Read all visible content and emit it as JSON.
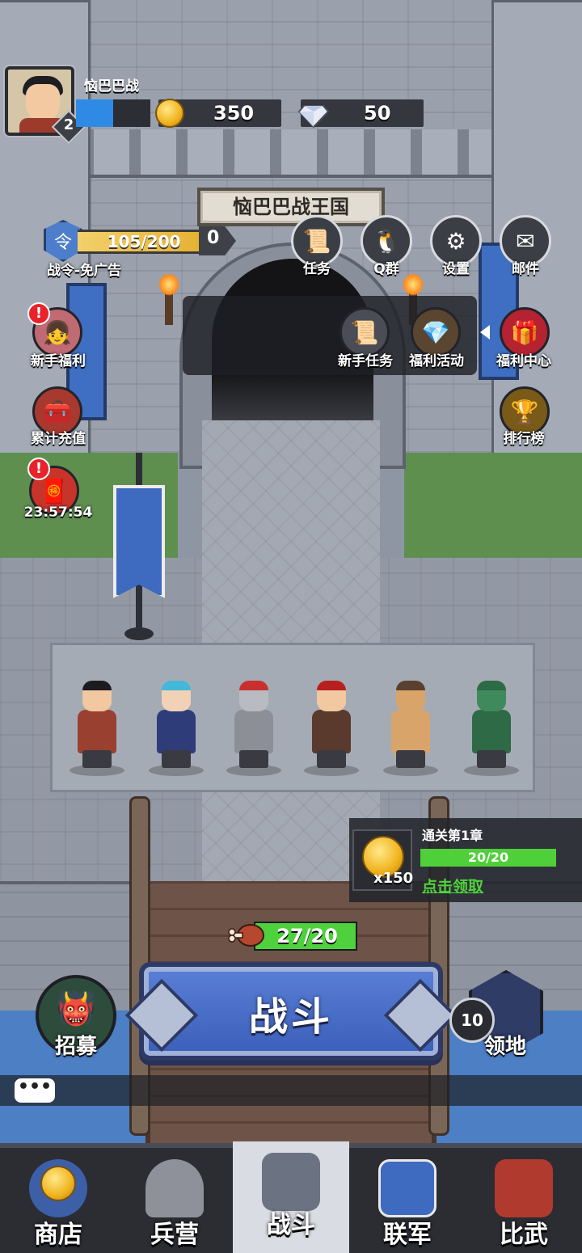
{
  "player": {
    "name": "恼巴巴战",
    "level": "2",
    "xp_fraction": 0.5,
    "gold": "350",
    "diamonds": "50"
  },
  "kingdom": {
    "title": "恼巴巴战王国"
  },
  "battle_pass": {
    "progress": "105/200",
    "progress_fraction": 0.525,
    "reward_count": "0",
    "label": "战令-免广告"
  },
  "top_buttons": [
    {
      "label": "任务",
      "icon": "scroll-icon"
    },
    {
      "label": "Q群",
      "icon": "penguin-icon"
    },
    {
      "label": "设置",
      "icon": "gear-icon"
    },
    {
      "label": "邮件",
      "icon": "envelope-icon"
    }
  ],
  "left_side": [
    {
      "label": "新手福利",
      "icon": "girl-portrait-icon",
      "alert": "!"
    },
    {
      "label": "累计充值",
      "icon": "treasure-chest-icon"
    },
    {
      "label": "23:57:54",
      "icon": "red-envelope-icon",
      "alert": "!"
    }
  ],
  "panel_items": [
    {
      "label": "新手任务",
      "icon": "scroll-icon"
    },
    {
      "label": "福利活动",
      "icon": "gem-chest-icon"
    }
  ],
  "right_side": [
    {
      "label": "福利中心",
      "icon": "gift-icon"
    },
    {
      "label": "排行榜",
      "icon": "trophy-icon"
    }
  ],
  "chapter_reward": {
    "title": "通关第1章",
    "quantity": "x150",
    "progress": "20/20",
    "progress_fraction": 1.0,
    "claim_label": "点击领取"
  },
  "stamina": {
    "value": "27/20",
    "fraction": 1.0
  },
  "battle_button": {
    "label": "战斗"
  },
  "recruit": {
    "label": "招募"
  },
  "territory": {
    "label": "领地",
    "level": "10"
  },
  "chat": {
    "label": "•••"
  },
  "nav": [
    {
      "label": "商店",
      "icon": "coin-shop-icon"
    },
    {
      "label": "兵营",
      "icon": "helmet-icon"
    },
    {
      "label": "战斗",
      "icon": "castle-icon",
      "active": true
    },
    {
      "label": "联军",
      "icon": "dragon-banner-icon"
    },
    {
      "label": "比武",
      "icon": "arena-icon"
    }
  ],
  "colors": {
    "xp": "#2f8ae6",
    "stamina": "#4ed13d",
    "battle_button": "#4a6fc8",
    "alert": "#e7232b",
    "claim": "#4fd23a"
  }
}
